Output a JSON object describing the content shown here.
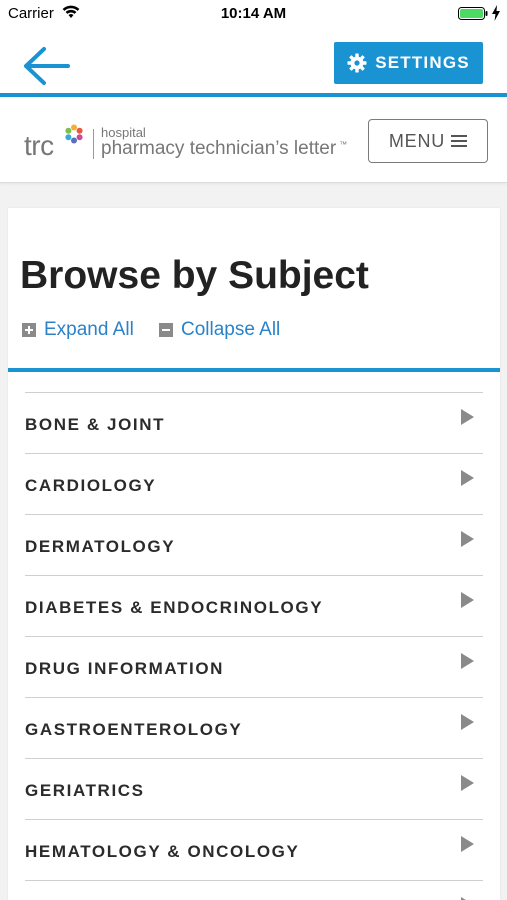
{
  "status_bar": {
    "carrier": "Carrier",
    "time": "10:14 AM"
  },
  "app_bar": {
    "back_icon": "arrow-left-icon",
    "settings_label": "SETTINGS",
    "settings_icon": "gear-icon",
    "accent_color": "#1a93d3"
  },
  "header": {
    "logo_trc": "trc",
    "logo_hospital": "hospital",
    "logo_title": "pharmacy technician’s letter",
    "logo_tm": "™",
    "menu_label": "MENU",
    "menu_icon": "hamburger-icon"
  },
  "main": {
    "title": "Browse by Subject",
    "expand_all": "Expand All",
    "collapse_all": "Collapse All",
    "subjects": [
      {
        "label": "BONE & JOINT"
      },
      {
        "label": "CARDIOLOGY"
      },
      {
        "label": "DERMATOLOGY"
      },
      {
        "label": "DIABETES & ENDOCRINOLOGY"
      },
      {
        "label": "DRUG INFORMATION"
      },
      {
        "label": "GASTROENTEROLOGY"
      },
      {
        "label": "GERIATRICS"
      },
      {
        "label": "HEMATOLOGY & ONCOLOGY"
      },
      {
        "label": ""
      }
    ]
  }
}
